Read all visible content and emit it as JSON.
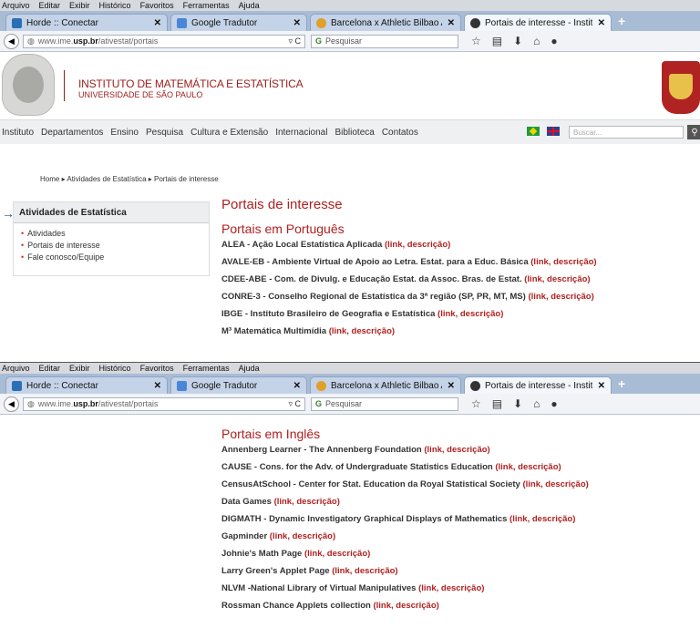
{
  "menu": [
    "Arquivo",
    "Editar",
    "Exibir",
    "Histórico",
    "Favoritos",
    "Ferramentas",
    "Ajuda"
  ],
  "tabs": [
    {
      "title": "Horde :: Conectar",
      "icon_color": "#2a6fb5"
    },
    {
      "title": "Google Tradutor",
      "icon_color": "#4a86d8"
    },
    {
      "title": "Barcelona x Athletic Bilbao Ao...",
      "icon_color": "#e0a02a"
    },
    {
      "title": "Portais de interesse - Institut...",
      "icon_color": "#333333",
      "active": true
    }
  ],
  "new_tab": "+",
  "url": {
    "prefix": "www.ime.",
    "bold": "usp.br",
    "suffix": "/ativestat/portais"
  },
  "search_placeholder": "Pesquisar",
  "site": {
    "institute": "INSTITUTO DE MATEMÁTICA E ESTATÍSTICA",
    "university": "UNIVERSIDADE DE SÃO PAULO"
  },
  "nav": [
    "Instituto",
    "Departamentos",
    "Ensino",
    "Pesquisa",
    "Cultura e Extensão",
    "Internacional",
    "Biblioteca",
    "Contatos"
  ],
  "site_search_placeholder": "Buscar...",
  "breadcrumb": "Home ▸ Atividades de Estatística ▸ Portais de interesse",
  "sidebar": {
    "title": "Atividades de Estatística",
    "items": [
      "Atividades",
      "Portais de interesse",
      "Fale conosco/Equipe"
    ]
  },
  "page_title": "Portais de interesse",
  "pt_section": {
    "title": "Portais em Português",
    "items": [
      "ALEA - Ação Local Estatística Aplicada",
      "AVALE-EB - Ambiente Virtual de Apoio ao Letra. Estat. para a Educ. Básica",
      "CDEE-ABE - Com. de Divulg. e Educação Estat. da Assoc. Bras. de Estat.",
      "CONRE-3 - Conselho Regional de Estatística da 3ª região (SP, PR, MT, MS)",
      "IBGE - Instituto Brasileiro de Geografia e Estatística",
      "M³ Matemática Multimídia"
    ]
  },
  "link_label": "(link, descrição)",
  "en_section": {
    "title": "Portais em Inglês",
    "items": [
      "Annenberg Learner - The Annenberg Foundation",
      "CAUSE - Cons. for the Adv. of Undergraduate Statistics Education",
      "CensusAtSchool - Center for Stat. Education da Royal Statistical Society",
      "Data Games",
      "DIGMATH - Dynamic Investigatory Graphical Displays of Mathematics",
      "Gapminder",
      "Johnie's Math Page",
      "Larry Green's Applet Page",
      "NLVM -National Library of Virtual Manipulatives",
      "Rossman Chance Applets collection"
    ]
  }
}
